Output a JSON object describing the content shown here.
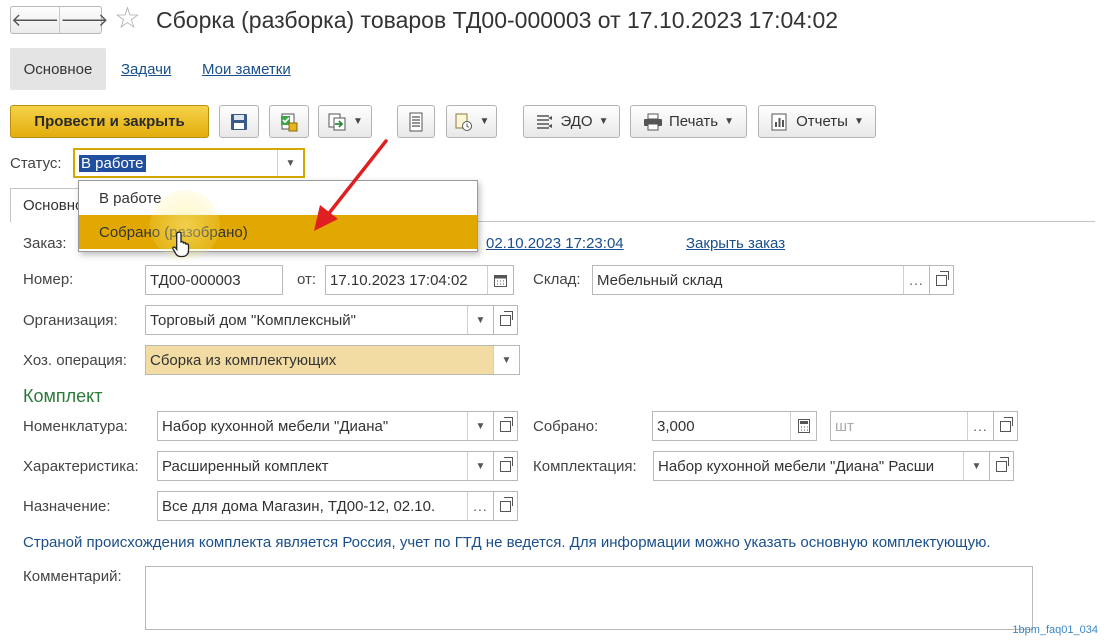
{
  "window": {
    "title": "Сборка (разборка) товаров ТД00-000003 от 17.10.2023 17:04:02"
  },
  "top_tabs": {
    "main": "Основное",
    "tasks": "Задачи",
    "notes": "Мои заметки"
  },
  "toolbar": {
    "post_close": "Провести и закрыть",
    "edo": "ЭДО",
    "print": "Печать",
    "reports": "Отчеты"
  },
  "status": {
    "label": "Статус:",
    "value": "В работе",
    "options": [
      "В работе",
      "Собрано (разобрано)"
    ],
    "highlighted_index": 1
  },
  "content_tab": {
    "label": "Основное"
  },
  "order": {
    "label": "Заказ:",
    "date_text": "02.10.2023 17:23:04",
    "close_link": "Закрыть заказ"
  },
  "fields": {
    "number_label": "Номер:",
    "number_value": "ТД00-000003",
    "date_label": "от:",
    "date_value": "17.10.2023 17:04:02",
    "warehouse_label": "Склад:",
    "warehouse_value": "Мебельный склад",
    "org_label": "Организация:",
    "org_value": "Торговый дом \"Комплексный\"",
    "operation_label": "Хоз. операция:",
    "operation_value": "Сборка из комплектующих"
  },
  "kit": {
    "section_title": "Комплект",
    "nomenclature_label": "Номенклатура:",
    "nomenclature_value": "Набор кухонной мебели \"Диана\"",
    "assembled_label": "Собрано:",
    "assembled_value": "3,000",
    "unit_placeholder": "шт",
    "characteristic_label": "Характеристика:",
    "characteristic_value": "Расширенный комплект",
    "kitting_label": "Комплектация:",
    "kitting_value": "Набор кухонной мебели \"Диана\" Расши",
    "purpose_label": "Назначение:",
    "purpose_value": "Все для дома Магазин, ТД00-12, 02.10."
  },
  "info_text": "Страной происхождения комплекта является Россия, учет по ГТД не ведется. Для информации можно указать основную комплектующую.",
  "comment_label": "Комментарий:",
  "watermark": "1bpm_faq01_034",
  "colors": {
    "primary_button": "#e3ad0c",
    "highlight": "#e0a800",
    "link": "#1a4f8b",
    "section": "#2a7a3a",
    "arrow": "#e02020"
  }
}
